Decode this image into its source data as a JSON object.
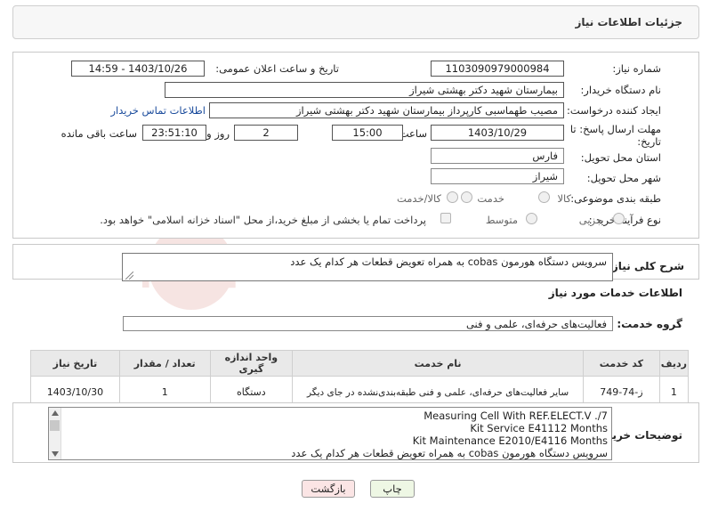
{
  "header": {
    "title": "جزئیات اطلاعات نیاز"
  },
  "form": {
    "need_number_label": "شماره نیاز:",
    "need_number": "1103090979000984",
    "announce_label": "تاریخ و ساعت اعلان عمومی:",
    "announce_value": "1403/10/26 - 14:59",
    "buyer_org_label": "نام دستگاه خریدار:",
    "buyer_org": "بیمارستان شهید دکتر بهشتی شیراز",
    "creator_label": "ایجاد کننده درخواست:",
    "creator": "مصیب طهماسبی کارپرداز بیمارستان شهید دکتر بهشتی شیراز",
    "contact_link": "اطلاعات تماس خریدار",
    "deadline_label_1": "مهلت ارسال پاسخ: تا",
    "deadline_label_2": "تاریخ:",
    "deadline_date": "1403/10/29",
    "time_label": "ساعت",
    "deadline_time": "15:00",
    "days_value": "2",
    "days_label": "روز و",
    "remaining_time": "23:51:10",
    "remaining_label": "ساعت باقی مانده",
    "province_label": "استان محل تحویل:",
    "province": "فارس",
    "city_label": "شهر محل تحویل:",
    "city": "شیراز",
    "category_label": "طبقه بندی موضوعی:",
    "category_options": [
      "کالا",
      "خدمت",
      "کالا/خدمت"
    ],
    "process_label": "نوع فرآیند خرید :",
    "process_options": [
      "جزیی",
      "متوسط"
    ],
    "payment_note": "پرداخت تمام یا بخشی از مبلغ خرید،از محل \"اسناد خزانه اسلامی\" خواهد بود."
  },
  "summary": {
    "label": "شرح کلی نیاز:",
    "text": "سرویس دستگاه هورمون cobas به همراه تعویض قطعات هر کدام یک عدد"
  },
  "services": {
    "section_title": "اطلاعات خدمات مورد نیاز",
    "group_label": "گروه خدمت:",
    "group_value": "فعالیت‌های حرفه‌ای، علمی و فنی",
    "columns": [
      "ردیف",
      "کد خدمت",
      "نام خدمت",
      "واحد اندازه گیری",
      "تعداد / مقدار",
      "تاریخ نیاز"
    ],
    "rows": [
      {
        "row": "1",
        "code": "ز-74-749",
        "name": "سایر فعالیت‌های حرفه‌ای، علمی و فنی طبقه‌بندی‌نشده در جای دیگر",
        "unit": "دستگاه",
        "qty": "1",
        "date": "1403/10/30"
      }
    ]
  },
  "buyer_notes": {
    "label": "توضیحات خریدار:",
    "lines": [
      "Measuring Cell With REF.ELECT.V ./7",
      "Kit Service E41112 Months",
      "Kit Maintenance E2010/E4116 Months",
      "سرویس دستگاه هورمون cobas به همراه تعویض قطعات هر کدام یک عدد"
    ]
  },
  "buttons": {
    "print": "چاپ",
    "back": "بازگشت"
  },
  "watermark": {
    "text": "AriaTender.neT"
  },
  "colors": {
    "accent_link": "#1a4b9c",
    "print_bg": "#eef7e4",
    "back_bg": "#fbe5e5"
  }
}
